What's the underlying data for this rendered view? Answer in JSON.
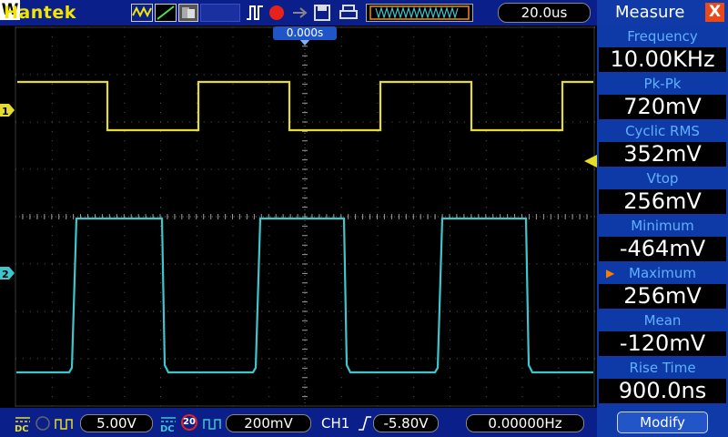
{
  "topbar": {
    "brand": "Hantek",
    "timebase": "20.0us",
    "acq_mode": "W",
    "trigger_position": "0.000s"
  },
  "panel": {
    "title": "Measure",
    "close_label": "X",
    "measurements": [
      {
        "label": "Frequency",
        "value": "10.00KHz"
      },
      {
        "label": "Pk-Pk",
        "value": "720mV"
      },
      {
        "label": "Cyclic RMS",
        "value": "352mV"
      },
      {
        "label": "Vtop",
        "value": "256mV"
      },
      {
        "label": "Minimum",
        "value": "-464mV"
      },
      {
        "label": "Maximum",
        "value": "256mV",
        "selected": true
      },
      {
        "label": "Mean",
        "value": "-120mV"
      },
      {
        "label": "Rise Time",
        "value": "900.0ns"
      }
    ],
    "modify_label": "Modify"
  },
  "bottombar": {
    "ch1_coupling": "DC",
    "ch1_scale": "5.00V",
    "ch2_coupling": "DC",
    "ch2_bw": "20",
    "ch2_scale": "200mV",
    "trigger_source": "CH1",
    "trigger_level": "-5.80V",
    "trigger_frequency": "0.00000Hz"
  },
  "channels": {
    "ch1": {
      "label": "1",
      "color": "#e6dc2c"
    },
    "ch2": {
      "label": "2",
      "color": "#3ec6cc"
    }
  }
}
